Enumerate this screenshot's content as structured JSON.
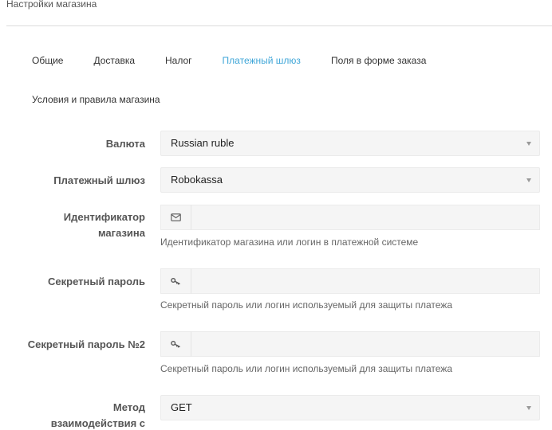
{
  "page": {
    "title": "Настройки магазина"
  },
  "tabs": [
    {
      "label": "Общие"
    },
    {
      "label": "Доставка"
    },
    {
      "label": "Налог"
    },
    {
      "label": "Платежный шлюз",
      "active": true
    },
    {
      "label": "Поля в форме заказа"
    }
  ],
  "tabs_row2": {
    "label": "Условия и правила магазина"
  },
  "form": {
    "currency": {
      "label": "Валюта",
      "value": "Russian ruble"
    },
    "gateway": {
      "label": "Платежный шлюз",
      "value": "Robokassa"
    },
    "shop_id": {
      "label_line1": "Идентификатор",
      "label_line2": "магазина",
      "value": "",
      "icon": "envelope-icon",
      "help": "Идентификатор магазина или логин в платежной системе"
    },
    "secret": {
      "label": "Секретный пароль",
      "value": "",
      "icon": "key-icon",
      "help": "Секретный пароль или логин используемый для защиты платежа"
    },
    "secret2": {
      "label": "Секретный пароль №2",
      "value": "",
      "icon": "key-icon",
      "help": "Секретный пароль или логин используемый для защиты платежа"
    },
    "method": {
      "label_line1": "Метод",
      "label_line2": "взаимодействия с",
      "value": "GET"
    }
  },
  "colors": {
    "accent": "#3fa6d8",
    "field_bg": "#f5f5f5"
  }
}
